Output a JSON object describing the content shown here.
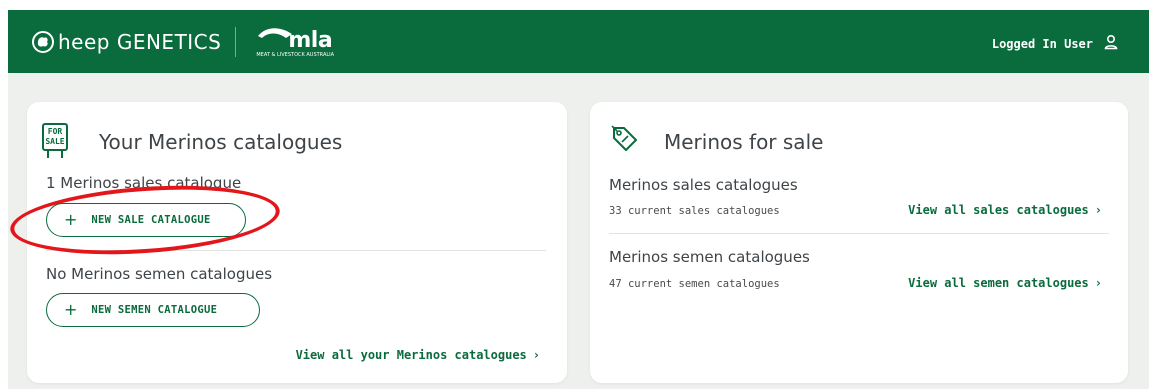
{
  "header": {
    "brand_text": "heep GENETICS",
    "partner_logo_text": "mla",
    "partner_logo_sub": "MEAT & LIVESTOCK AUSTRALIA",
    "user_label": "Logged In User"
  },
  "your_catalogues": {
    "title": "Your Merinos catalogues",
    "icon_text_top": "FOR",
    "icon_text_bottom": "SALE",
    "sales_status": "1 Merinos sales catalogue",
    "new_sale_button": "NEW SALE CATALOGUE",
    "semen_status": "No Merinos semen catalogues",
    "new_semen_button": "NEW SEMEN CATALOGUE",
    "view_all_link": "View all your Merinos catalogues"
  },
  "for_sale": {
    "title": "Merinos for sale",
    "sales_heading": "Merinos sales catalogues",
    "sales_count": "33 current sales catalogues",
    "sales_link": "View all sales catalogues",
    "semen_heading": "Merinos semen catalogues",
    "semen_count": "47 current semen catalogues",
    "semen_link": "View all semen catalogues"
  },
  "colors": {
    "brand_green": "#0a6b3d",
    "annotation_red": "#e3161b"
  },
  "icons": [
    "sheep-logo-icon",
    "mla-logo-icon",
    "user-icon",
    "for-sale-icon",
    "tag-icon",
    "plus-icon",
    "chevron-right-icon"
  ]
}
